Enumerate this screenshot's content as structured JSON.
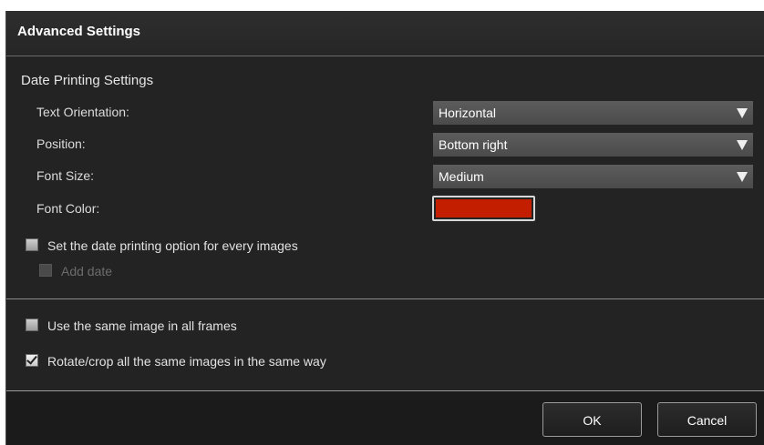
{
  "dialog": {
    "title": "Advanced Settings"
  },
  "date_printing": {
    "section_title": "Date Printing Settings",
    "text_orientation": {
      "label": "Text Orientation:",
      "value": "Horizontal"
    },
    "position": {
      "label": "Position:",
      "value": "Bottom right"
    },
    "font_size": {
      "label": "Font Size:",
      "value": "Medium"
    },
    "font_color": {
      "label": "Font Color:",
      "color": "#c41e00"
    },
    "every_images": {
      "label": "Set the date printing option for every images",
      "checked": false
    },
    "add_date": {
      "label": "Add date",
      "checked": false,
      "enabled": false
    }
  },
  "options": {
    "same_image": {
      "label": "Use the same image in all frames",
      "checked": false
    },
    "rotate_crop": {
      "label": "Rotate/crop all the same images in the same way",
      "checked": true
    }
  },
  "buttons": {
    "ok": "OK",
    "cancel": "Cancel"
  },
  "icons": {
    "dropdown_arrow": "triangle-down-icon",
    "checkmark": "check-icon"
  }
}
